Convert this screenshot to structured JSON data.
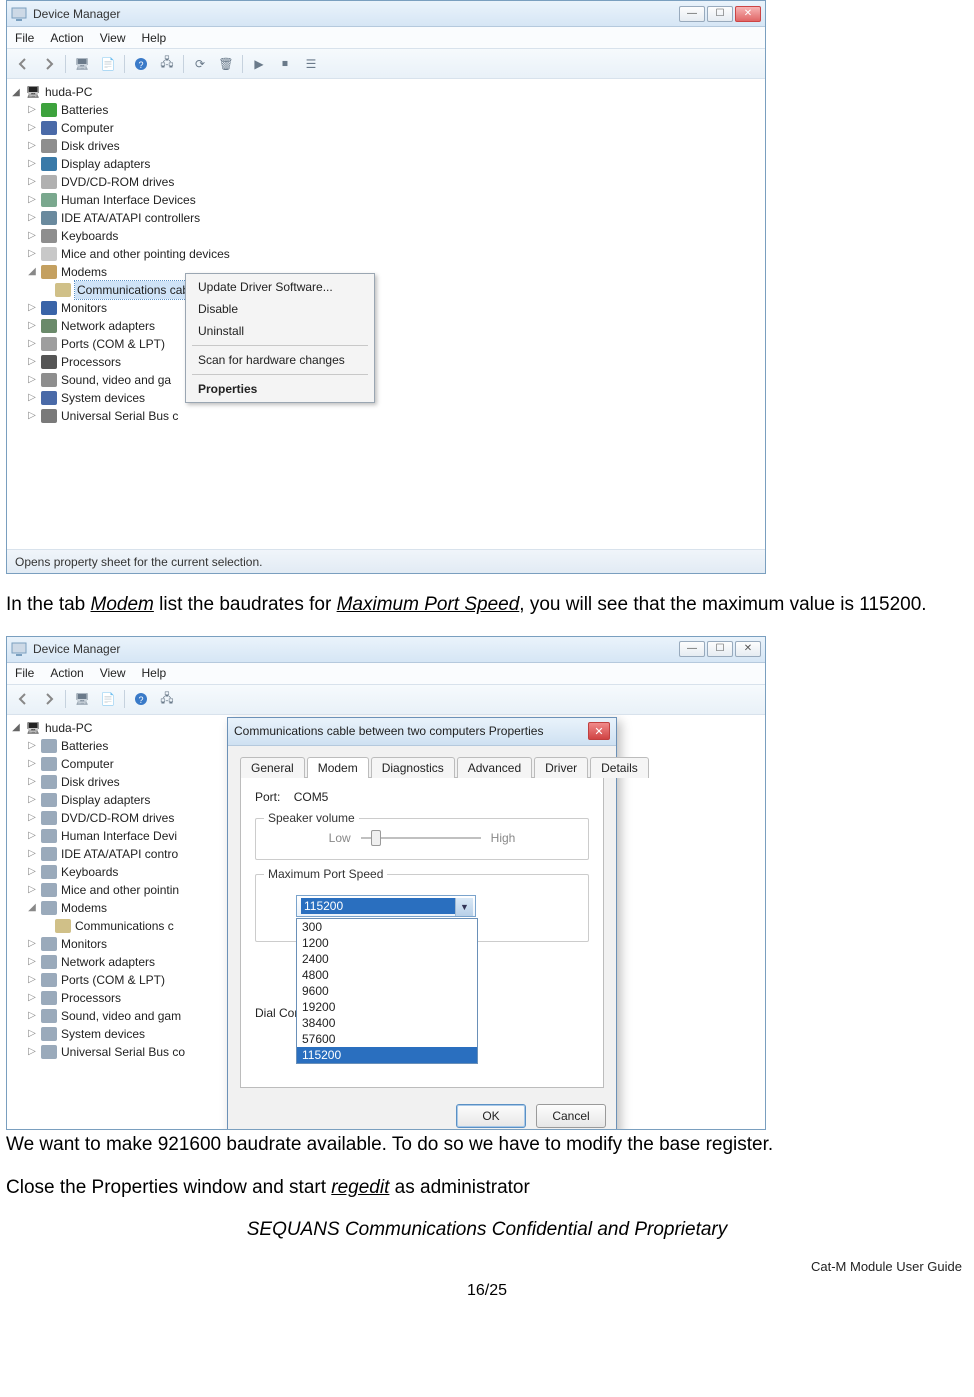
{
  "screenshot1": {
    "window_title": "Device Manager",
    "menus": [
      "File",
      "Action",
      "View",
      "Help"
    ],
    "root": "huda-PC",
    "nodes": [
      {
        "label": "Batteries",
        "color": "#3da23d"
      },
      {
        "label": "Computer",
        "color": "#4a6aa8"
      },
      {
        "label": "Disk drives",
        "color": "#8e8e8e"
      },
      {
        "label": "Display adapters",
        "color": "#3a7aa8"
      },
      {
        "label": "DVD/CD-ROM drives",
        "color": "#b0b0b0"
      },
      {
        "label": "Human Interface Devices",
        "color": "#7aa88e"
      },
      {
        "label": "IDE ATA/ATAPI controllers",
        "color": "#6a8a9e"
      },
      {
        "label": "Keyboards",
        "color": "#8e8e8e"
      },
      {
        "label": "Mice and other pointing devices",
        "color": "#c8c8c8"
      },
      {
        "label": "Modems",
        "color": "#c4a060",
        "expanded": true,
        "children": [
          {
            "label": "Communications cable between two computers",
            "selected": true
          }
        ]
      },
      {
        "label": "Monitors",
        "color": "#3a64a8"
      },
      {
        "label": "Network adapters",
        "color": "#6a8a6a"
      },
      {
        "label": "Ports (COM & LPT)",
        "color": "#9e9e9e"
      },
      {
        "label": "Processors",
        "color": "#555555"
      },
      {
        "label": "Sound, video and ga",
        "color": "#8e8e8e"
      },
      {
        "label": "System devices",
        "color": "#4a6aa8"
      },
      {
        "label": "Universal Serial Bus c",
        "color": "#7a7a7a"
      }
    ],
    "context_menu": [
      "Update Driver Software...",
      "Disable",
      "Uninstall",
      "---",
      "Scan for hardware changes",
      "---",
      "Properties"
    ],
    "status_text": "Opens property sheet for the current selection."
  },
  "para1_pre": "In the tab ",
  "para1_u1": "Modem",
  "para1_mid": " list the baudrates for ",
  "para1_u2": "Maximum Port Speed",
  "para1_post": ", you will see that the maximum value is 115200.",
  "screenshot2": {
    "window_title": "Device Manager",
    "menus": [
      "File",
      "Action",
      "View",
      "Help"
    ],
    "root": "huda-PC",
    "nodes2": [
      {
        "label": "Batteries"
      },
      {
        "label": "Computer"
      },
      {
        "label": "Disk drives"
      },
      {
        "label": "Display adapters"
      },
      {
        "label": "DVD/CD-ROM drives"
      },
      {
        "label": "Human Interface Devi"
      },
      {
        "label": "IDE ATA/ATAPI contro"
      },
      {
        "label": "Keyboards"
      },
      {
        "label": "Mice and other pointin"
      },
      {
        "label": "Modems",
        "expanded": true,
        "children": [
          {
            "label": "Communications c"
          }
        ]
      },
      {
        "label": "Monitors"
      },
      {
        "label": "Network adapters"
      },
      {
        "label": "Ports (COM & LPT)"
      },
      {
        "label": "Processors"
      },
      {
        "label": "Sound, video and gam"
      },
      {
        "label": "System devices"
      },
      {
        "label": "Universal Serial Bus co"
      }
    ],
    "dialog": {
      "title": "Communications cable between two computers Properties",
      "tabs": [
        "General",
        "Modem",
        "Diagnostics",
        "Advanced",
        "Driver",
        "Details"
      ],
      "active_tab": "Modem",
      "port_label": "Port:",
      "port_value": "COM5",
      "speaker_group": "Speaker volume",
      "slider_low": "Low",
      "slider_high": "High",
      "speed_group": "Maximum Port Speed",
      "speed_selected": "115200",
      "speed_options": [
        "300",
        "1200",
        "2400",
        "4800",
        "9600",
        "19200",
        "38400",
        "57600",
        "115200"
      ],
      "dial_label": "Dial Cont",
      "ok": "OK",
      "cancel": "Cancel"
    }
  },
  "para2": "We want to make 921600 baudrate available. To do so we have to modify the base register.",
  "para3_pre": "Close the Properties window and start ",
  "para3_u": "regedit",
  "para3_post": " as administrator",
  "confidential": "SEQUANS Communications Confidential and Proprietary",
  "doc_title": "Cat-M Module User Guide",
  "page_number": "16/25"
}
